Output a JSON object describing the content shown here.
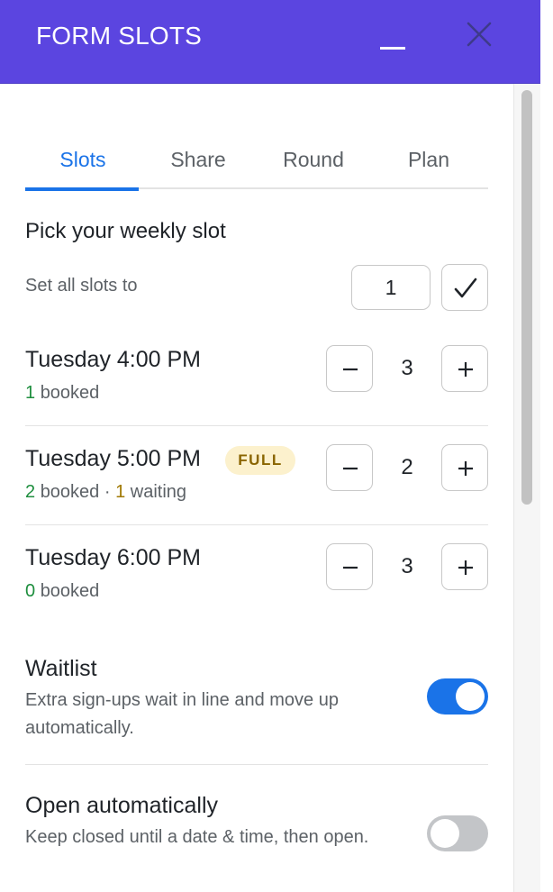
{
  "header": {
    "title": "FORM SLOTS",
    "bg_color": "#5b45e0",
    "minimize_icon": "minimize-icon",
    "close_icon": "close-icon"
  },
  "tabs": [
    {
      "label": "Slots",
      "active": true
    },
    {
      "label": "Share",
      "active": false
    },
    {
      "label": "Round",
      "active": false
    },
    {
      "label": "Plan",
      "active": false
    }
  ],
  "section_title": "Pick your weekly slot",
  "set_all": {
    "label": "Set all slots to",
    "value": "1",
    "apply_icon": "check-icon"
  },
  "slots": [
    {
      "time": "Tuesday 4:00 PM",
      "booked": "1",
      "booked_label": "booked",
      "capacity": "3",
      "badge": "",
      "separator": "",
      "waiting": "",
      "waiting_label": ""
    },
    {
      "time": "Tuesday 5:00 PM",
      "booked": "2",
      "booked_label": "booked",
      "capacity": "2",
      "badge": "FULL",
      "separator": " · ",
      "waiting": "1",
      "waiting_label": "waiting"
    },
    {
      "time": "Tuesday 6:00 PM",
      "booked": "0",
      "booked_label": "booked",
      "capacity": "3",
      "badge": "",
      "separator": "",
      "waiting": "",
      "waiting_label": ""
    }
  ],
  "options": {
    "waitlist": {
      "title": "Waitlist",
      "description": "Extra sign-ups wait in line and move up automatically.",
      "enabled": true
    },
    "open_automatically": {
      "title": "Open automatically",
      "description": "Keep closed until a date & time, then open.",
      "enabled": false
    }
  },
  "colors": {
    "accent": "#1a73e8",
    "booked_green": "#1e8e3e",
    "waiting_amber": "#a07800",
    "badge_bg": "#fcf1cd"
  }
}
